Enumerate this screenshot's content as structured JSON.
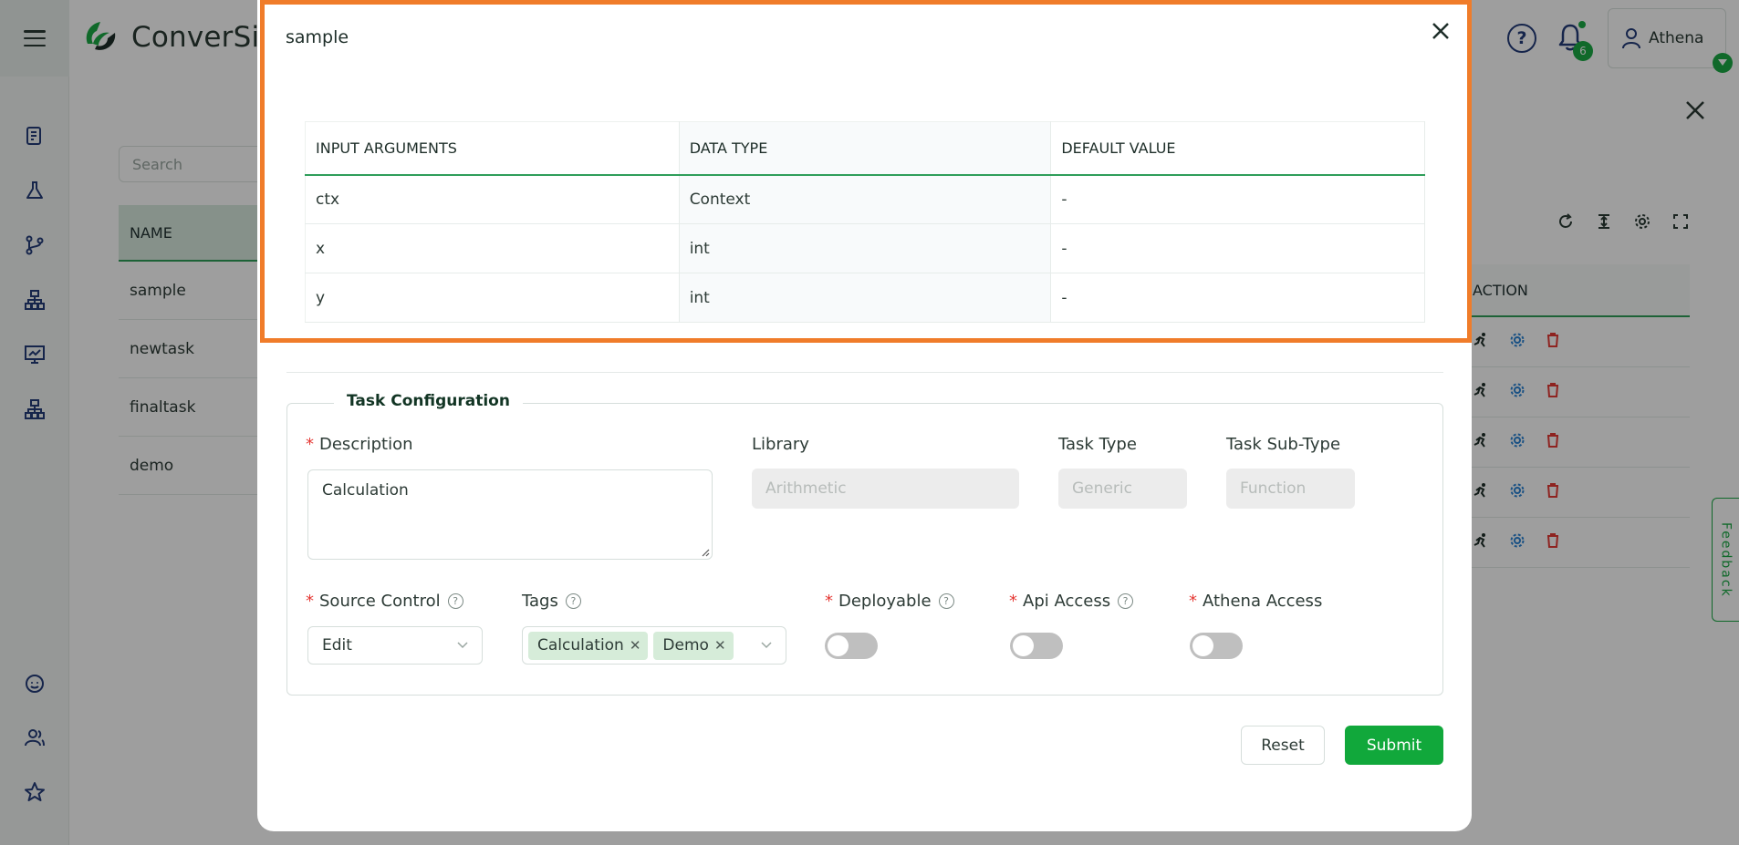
{
  "app": {
    "logo_text": "ConverSig",
    "user_name": "Athena",
    "notification_count": "6",
    "search_placeholder": "Search",
    "name_column": "NAME",
    "rows": [
      "sample",
      "newtask",
      "finaltask",
      "demo"
    ],
    "action_column": "ACTION",
    "feedback_label": "Feedback",
    "colors": {
      "brand_green": "#1aaa45",
      "highlight": "#f07c2a"
    }
  },
  "modal": {
    "title": "sample",
    "args_table": {
      "headers": [
        "INPUT ARGUMENTS",
        "DATA TYPE",
        "DEFAULT VALUE"
      ],
      "rows": [
        [
          "ctx",
          "Context",
          "-"
        ],
        [
          "x",
          "int",
          "-"
        ],
        [
          "y",
          "int",
          "-"
        ]
      ]
    },
    "config": {
      "legend": "Task Configuration",
      "description_label": "Description",
      "description_value": "Calculation",
      "library_label": "Library",
      "library_placeholder": "Arithmetic",
      "task_type_label": "Task Type",
      "task_type_placeholder": "Generic",
      "task_subtype_label": "Task Sub-Type",
      "task_subtype_placeholder": "Function",
      "source_control_label": "Source Control",
      "source_control_value": "Edit",
      "tags_label": "Tags",
      "tags": [
        "Calculation",
        "Demo"
      ],
      "deployable_label": "Deployable",
      "api_access_label": "Api Access",
      "athena_access_label": "Athena Access",
      "req_mark": "*",
      "help_mark": "?"
    },
    "reset_label": "Reset",
    "submit_label": "Submit"
  }
}
